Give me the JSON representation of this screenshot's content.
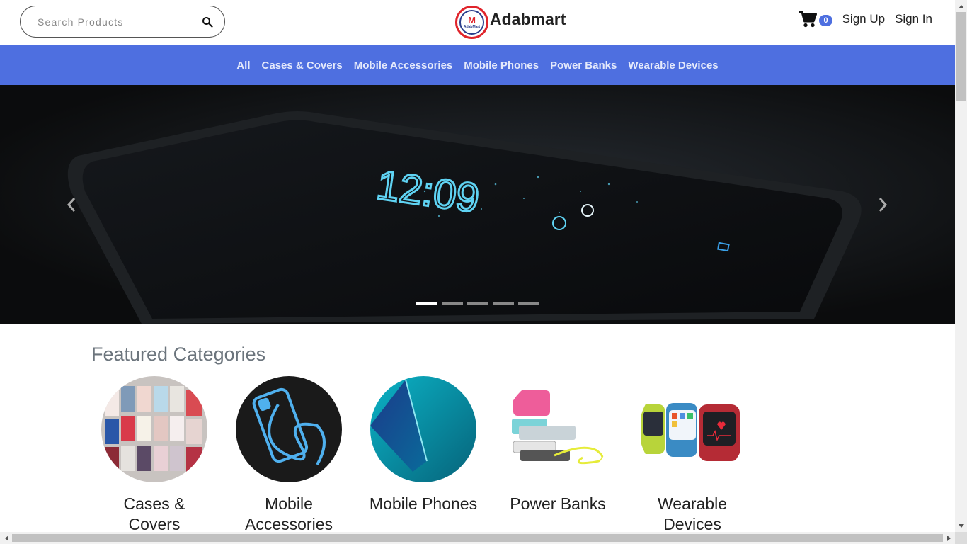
{
  "header": {
    "search_placeholder": "Search Products",
    "brand_name": "Adabmart",
    "logo_text": "AdabMart",
    "cart_count": "0",
    "signup": "Sign Up",
    "signin": "Sign In"
  },
  "nav": {
    "items": [
      "All",
      "Cases & Covers",
      "Mobile Accessories",
      "Mobile Phones",
      "Power Banks",
      "Wearable Devices"
    ]
  },
  "carousel": {
    "slide_count": 5,
    "active_index": 0,
    "phone_time": "12:09"
  },
  "featured": {
    "title": "Featured Categories",
    "categories": [
      {
        "label": "Cases & Covers",
        "image": "cases-image"
      },
      {
        "label": "Mobile Accessories",
        "image": "accessories-image"
      },
      {
        "label": "Mobile Phones",
        "image": "phones-image"
      },
      {
        "label": "Power Banks",
        "image": "powerbanks-image"
      },
      {
        "label": "Wearable Devices",
        "image": "wearables-image"
      }
    ]
  },
  "colors": {
    "nav_bg": "#4e6fe0",
    "badge_bg": "#4e6fe0",
    "logo_ring": "#e0242b",
    "title_gray": "#6c757d"
  }
}
